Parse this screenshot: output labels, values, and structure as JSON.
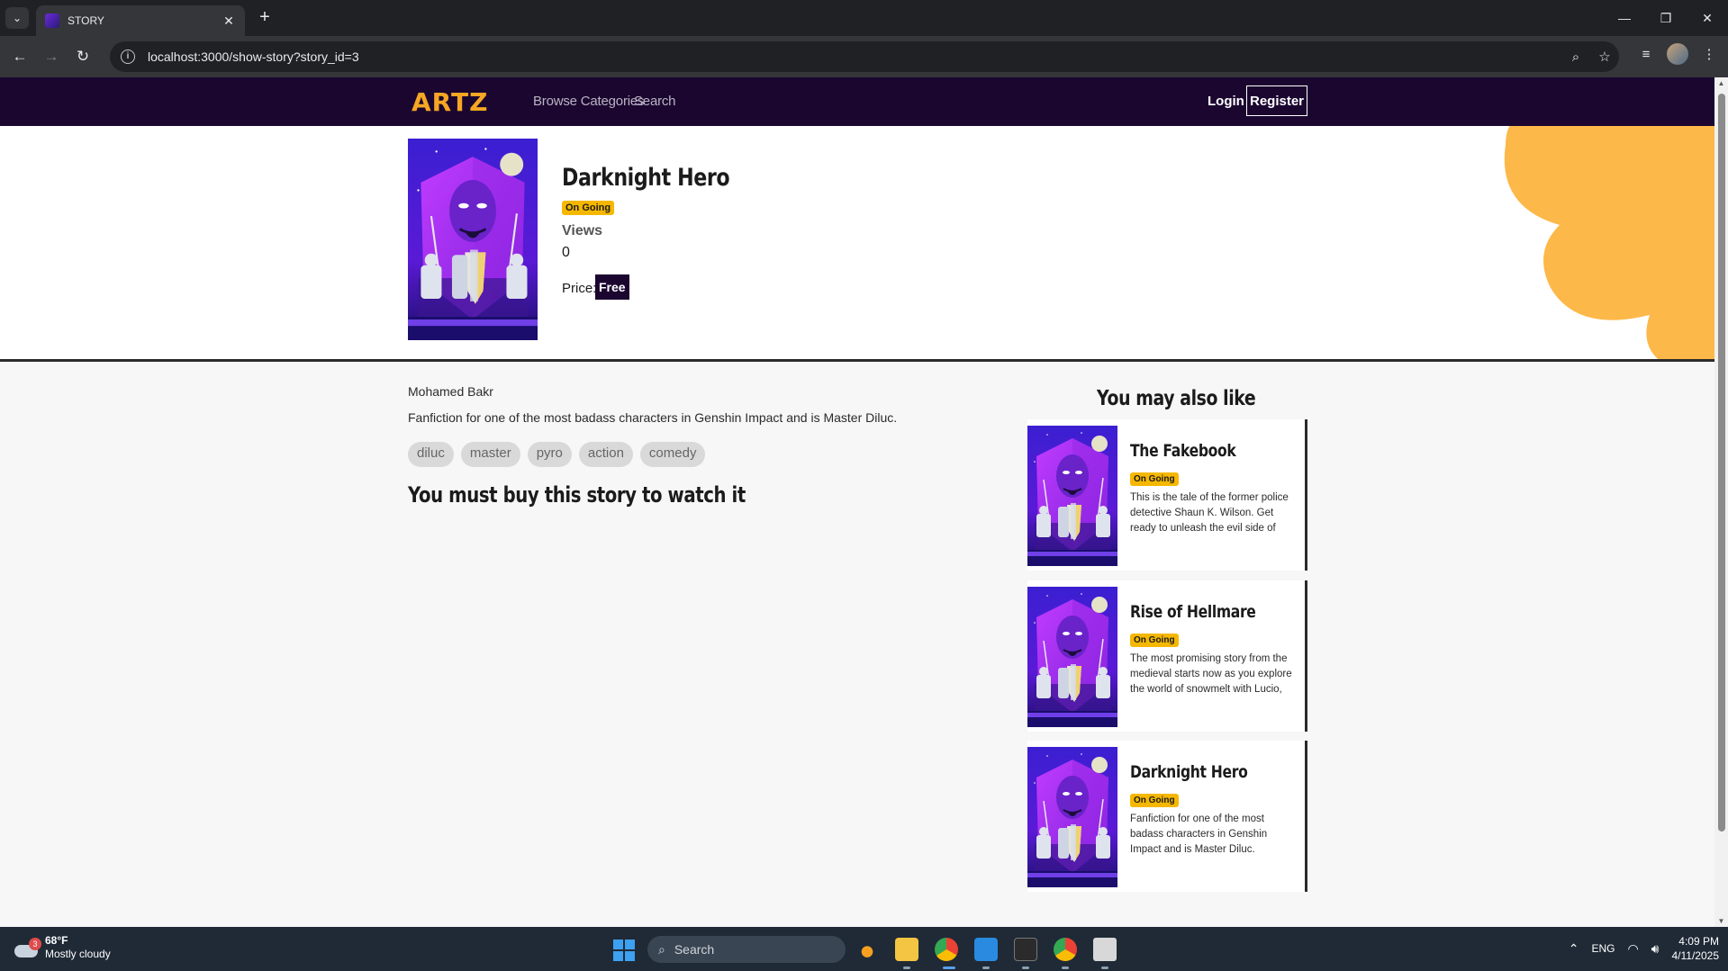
{
  "browser": {
    "tab_title": "STORY",
    "url": "localhost:3000/show-story?story_id=3"
  },
  "site": {
    "logo": "ARTZ",
    "nav": {
      "browse": "Browse Categories",
      "search": "Search",
      "login": "Login",
      "register": "Register"
    }
  },
  "story": {
    "title": "Darknight Hero",
    "status": "On Going",
    "views_label": "Views",
    "views": "0",
    "price_label": "Price:",
    "price": "Free",
    "author": "Mohamed Bakr",
    "description": "Fanfiction for one of the most badass characters in Genshin Impact and is Master Diluc.",
    "tags": [
      "diluc",
      "master",
      "pyro",
      "action",
      "comedy"
    ],
    "buy_message": "You must buy this story to watch it"
  },
  "recommendations": {
    "heading": "You may also like",
    "items": [
      {
        "title": "The Fakebook",
        "status": "On Going",
        "description": "This is the tale of the former police detective Shaun K. Wilson. Get ready to unleash the evil side of Shaun that's goin..."
      },
      {
        "title": "Rise of Hellmare",
        "status": "On Going",
        "description": "The most promising story from the medieval starts now as you explore the world of snowmelt with Lucio, Azure and..."
      },
      {
        "title": "Darknight Hero",
        "status": "On Going",
        "description": "Fanfiction for one of the most badass characters in Genshin Impact and is Master Diluc."
      }
    ]
  },
  "taskbar": {
    "weather_temp": "68°F",
    "weather_desc": "Mostly cloudy",
    "weather_badge": "3",
    "search_placeholder": "Search",
    "lang": "ENG",
    "time": "4:09 PM",
    "date": "4/11/2025"
  },
  "colors": {
    "nav_bg": "#1b0630",
    "accent": "#f5a623",
    "badge": "#f5b700"
  }
}
